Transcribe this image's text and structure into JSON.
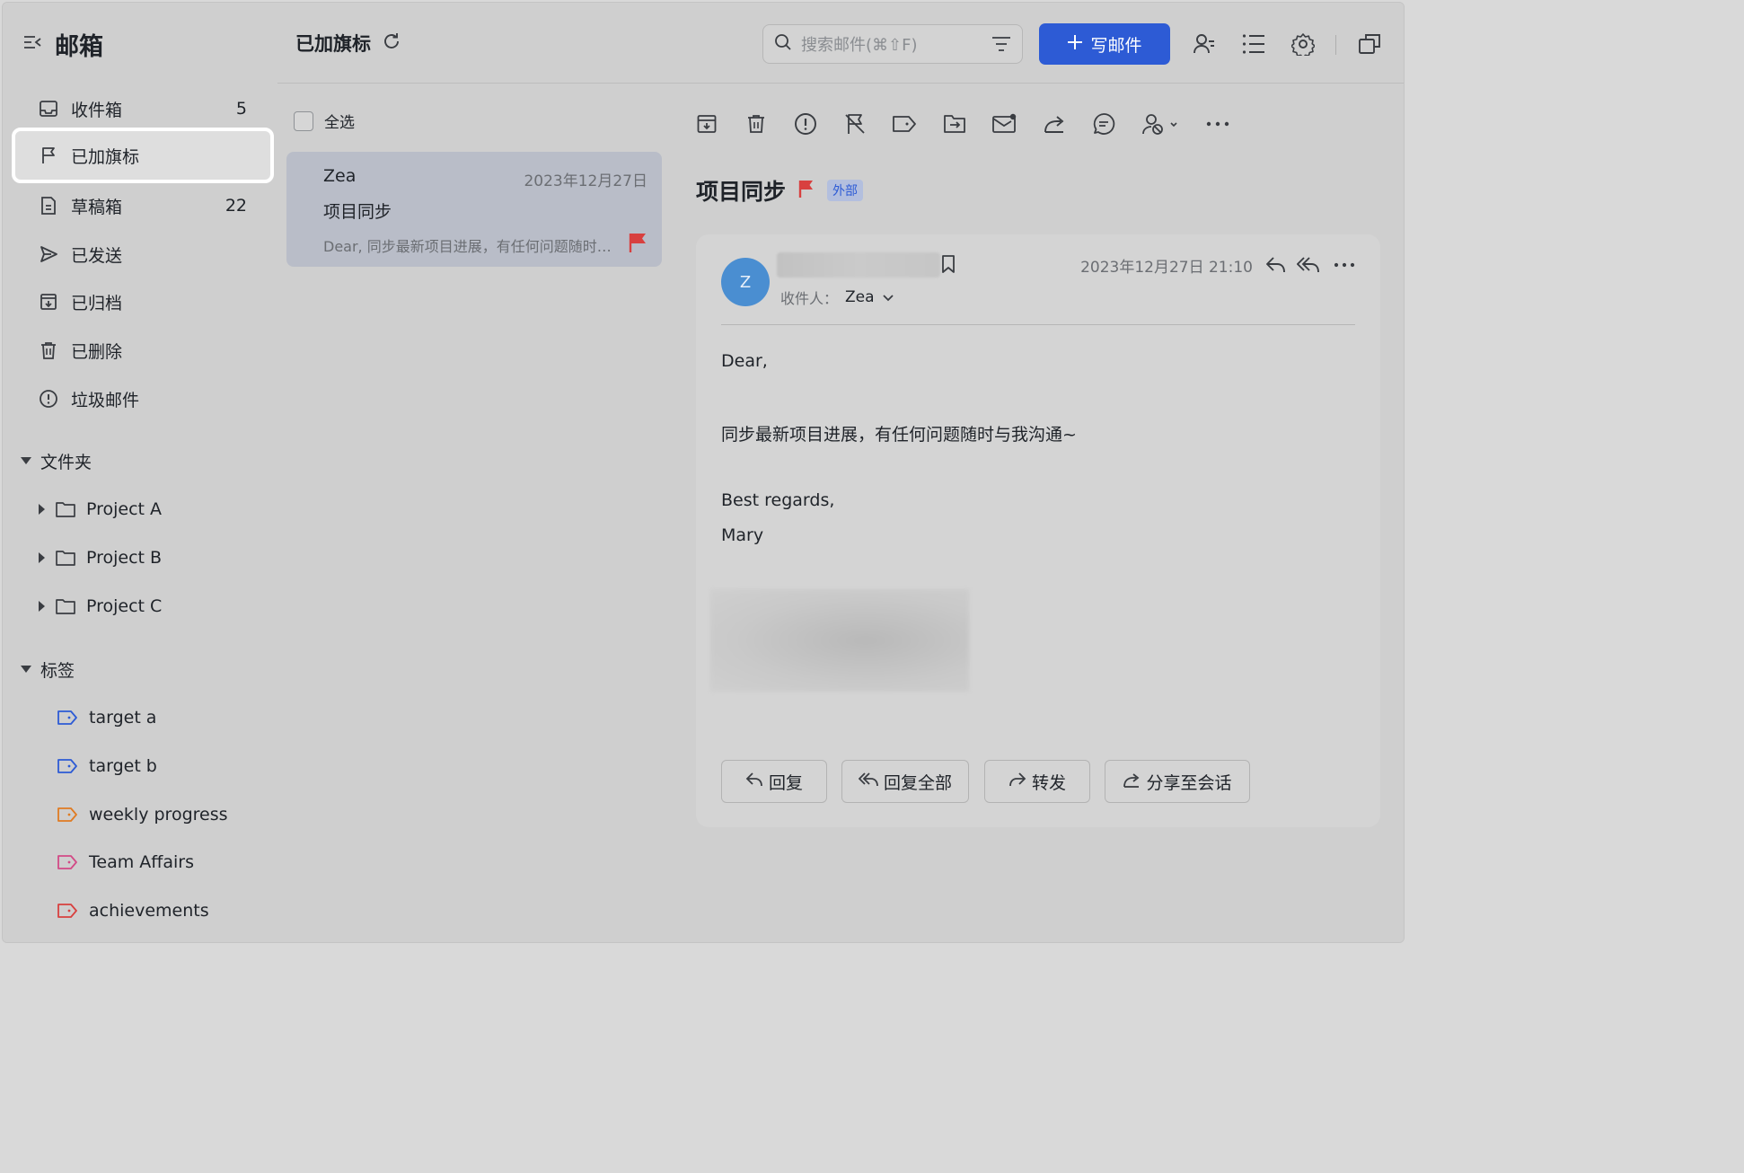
{
  "sidebar": {
    "title": "邮箱",
    "nav": [
      {
        "label": "收件箱",
        "count": "5",
        "icon": "inbox-icon"
      },
      {
        "label": "已加旗标",
        "count": "",
        "icon": "flag-icon"
      },
      {
        "label": "草稿箱",
        "count": "22",
        "icon": "draft-icon"
      },
      {
        "label": "已发送",
        "count": "",
        "icon": "send-icon"
      },
      {
        "label": "已归档",
        "count": "",
        "icon": "archive-icon"
      },
      {
        "label": "已删除",
        "count": "",
        "icon": "trash-icon"
      },
      {
        "label": "垃圾邮件",
        "count": "",
        "icon": "spam-icon"
      }
    ],
    "folders_title": "文件夹",
    "folders": [
      {
        "label": "Project A"
      },
      {
        "label": "Project B"
      },
      {
        "label": "Project C"
      }
    ],
    "tags_title": "标签",
    "tags": [
      {
        "label": "target a",
        "color": "#2d5bd5"
      },
      {
        "label": "target b",
        "color": "#2d5bd5"
      },
      {
        "label": "weekly progress",
        "color": "#e07b22"
      },
      {
        "label": "Team Affairs",
        "color": "#d24a86"
      },
      {
        "label": "achievements",
        "color": "#d8403f"
      }
    ]
  },
  "header": {
    "title": "已加旗标",
    "search_placeholder": "搜索邮件(⌘⇧F)",
    "compose_label": "写邮件",
    "accent": "#2d5bd5"
  },
  "list": {
    "select_all": "全选",
    "messages": [
      {
        "from": "Zea",
        "date": "2023年12月27日",
        "subject": "项目同步",
        "preview": "Dear, 同步最新项目进展，有任何问题随时与我沟通~",
        "flagged": true
      }
    ]
  },
  "reader": {
    "subject": "项目同步",
    "badge": "外部",
    "to_label": "收件人：",
    "to_name": "Zea",
    "avatar_letter": "Z",
    "datetime": "2023年12月27日 21:10",
    "body": {
      "greeting": "Dear,",
      "line1": "同步最新项目进展，有任何问题随时与我沟通~",
      "closing": "Best regards,",
      "signature": "Mary"
    },
    "actions": {
      "reply": "回复",
      "reply_all": "回复全部",
      "forward": "转发",
      "share": "分享至会话"
    }
  },
  "colors": {
    "flag": "#d8403f",
    "avatar": "#4a8ed1"
  }
}
